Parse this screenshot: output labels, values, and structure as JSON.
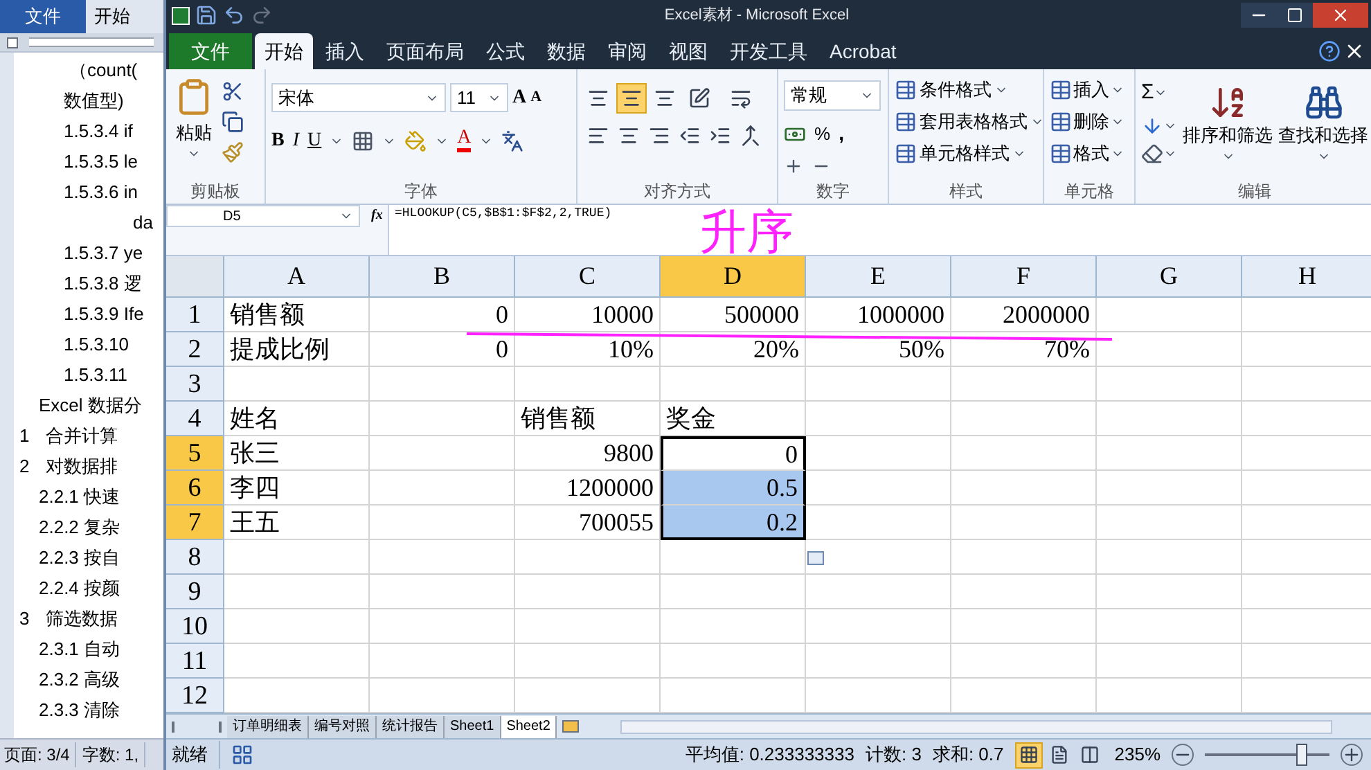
{
  "word": {
    "file_tab": "文件",
    "tabs": [
      "开始"
    ],
    "lines": [
      {
        "kind": "para",
        "text": "（count("
      },
      {
        "kind": "para2",
        "text": "数值型)"
      },
      {
        "kind": "sub",
        "text": "1.5.3.4 if"
      },
      {
        "kind": "sub",
        "text": "1.5.3.5 le"
      },
      {
        "kind": "sub",
        "text": "1.5.3.6 in"
      },
      {
        "kind": "cont",
        "text": "da"
      },
      {
        "kind": "sub",
        "text": "1.5.3.7 ye"
      },
      {
        "kind": "sub",
        "text": "1.5.3.8 逻"
      },
      {
        "kind": "sub",
        "text": "1.5.3.9 Ife"
      },
      {
        "kind": "sub",
        "text": "1.5.3.10"
      },
      {
        "kind": "sub",
        "text": "1.5.3.11"
      },
      {
        "kind": "chapter",
        "text": "Excel 数据分"
      },
      {
        "kind": "section",
        "number": "1",
        "text": "合并计算"
      },
      {
        "kind": "section",
        "number": "2",
        "text": "对数据排"
      },
      {
        "kind": "item",
        "text": "2.2.1 快速"
      },
      {
        "kind": "item",
        "text": "2.2.2 复杂"
      },
      {
        "kind": "item",
        "text": "2.2.3 按自"
      },
      {
        "kind": "item",
        "text": "2.2.4 按颜"
      },
      {
        "kind": "section",
        "number": "3",
        "text": "筛选数据"
      },
      {
        "kind": "item",
        "text": "2.3.1 自动"
      },
      {
        "kind": "item",
        "text": "2.3.2 高级"
      },
      {
        "kind": "item",
        "text": "2.3.3 清除"
      }
    ],
    "status": [
      "页面: 3/4",
      "字数: 1,"
    ]
  },
  "excel": {
    "title": "Excel素材 - Microsoft Excel",
    "file_tab": "文件",
    "tabs": [
      {
        "label": "开始",
        "selected": true
      },
      {
        "label": "插入",
        "selected": false
      },
      {
        "label": "页面布局",
        "selected": false
      },
      {
        "label": "公式",
        "selected": false
      },
      {
        "label": "数据",
        "selected": false
      },
      {
        "label": "审阅",
        "selected": false
      },
      {
        "label": "视图",
        "selected": false
      },
      {
        "label": "开发工具",
        "selected": false
      },
      {
        "label": "Acrobat",
        "selected": false
      }
    ],
    "ribbon": {
      "clipboard": {
        "paste": "粘贴",
        "label": "剪贴板"
      },
      "font": {
        "name": "宋体",
        "size": "11",
        "grow": "A",
        "shrink": "A",
        "bold": "B",
        "italic": "I",
        "underline": "U",
        "color_letter": "A",
        "label": "字体"
      },
      "alignment": {
        "label": "对齐方式",
        "vertical": [
          {
            "selected": false
          },
          {
            "selected": true
          },
          {
            "selected": false
          }
        ]
      },
      "number": {
        "format": "常规",
        "percent": "%",
        "comma": ",",
        "label": "数字"
      },
      "styles": {
        "items": [
          "条件格式",
          "套用表格格式",
          "单元格样式"
        ],
        "label": "样式"
      },
      "cells": {
        "items": [
          "插入",
          "删除",
          "格式"
        ],
        "label": "单元格"
      },
      "editing": {
        "sum": "Σ",
        "sort": "排序和筛选",
        "find": "查找和选择",
        "label": "编辑"
      }
    },
    "name_box": "D5",
    "function_label": "fx",
    "formula": "=HLOOKUP(C5,$B$1:$F$2,2,TRUE)",
    "annotation": "升序",
    "grid": {
      "columns": [
        {
          "label": "A",
          "selected": false
        },
        {
          "label": "B",
          "selected": false
        },
        {
          "label": "C",
          "selected": false
        },
        {
          "label": "D",
          "selected": true
        },
        {
          "label": "E",
          "selected": false
        },
        {
          "label": "F",
          "selected": false
        },
        {
          "label": "G",
          "selected": false
        },
        {
          "label": "H",
          "selected": false
        }
      ],
      "rows": [
        {
          "label": "1",
          "selected": false,
          "cells": [
            {
              "text": "销售额",
              "kind": "text"
            },
            {
              "text": "0",
              "kind": "number"
            },
            {
              "text": "10000",
              "kind": "number"
            },
            {
              "text": "500000",
              "kind": "number"
            },
            {
              "text": "1000000",
              "kind": "number"
            },
            {
              "text": "2000000",
              "kind": "number"
            },
            {},
            {}
          ]
        },
        {
          "label": "2",
          "selected": false,
          "cells": [
            {
              "text": "提成比例",
              "kind": "text"
            },
            {
              "text": "0",
              "kind": "number"
            },
            {
              "text": "10%",
              "kind": "number"
            },
            {
              "text": "20%",
              "kind": "number"
            },
            {
              "text": "50%",
              "kind": "number"
            },
            {
              "text": "70%",
              "kind": "number"
            },
            {},
            {}
          ]
        },
        {
          "label": "3",
          "selected": false,
          "cells": [
            {},
            {},
            {},
            {},
            {},
            {},
            {},
            {}
          ]
        },
        {
          "label": "4",
          "selected": false,
          "cells": [
            {
              "text": "姓名",
              "kind": "text"
            },
            {},
            {
              "text": "销售额",
              "kind": "text"
            },
            {
              "text": "奖金",
              "kind": "text"
            },
            {},
            {},
            {},
            {}
          ]
        },
        {
          "label": "5",
          "selected": true,
          "cells": [
            {
              "text": "张三",
              "kind": "text"
            },
            {},
            {
              "text": "9800",
              "kind": "number"
            },
            {
              "text": "0",
              "kind": "number",
              "selected": true,
              "active": true
            },
            {},
            {},
            {},
            {}
          ]
        },
        {
          "label": "6",
          "selected": true,
          "cells": [
            {
              "text": "李四",
              "kind": "text"
            },
            {},
            {
              "text": "1200000",
              "kind": "number"
            },
            {
              "text": "0.5",
              "kind": "number",
              "selected": true,
              "active": false
            },
            {},
            {},
            {},
            {}
          ]
        },
        {
          "label": "7",
          "selected": true,
          "cells": [
            {
              "text": "王五",
              "kind": "text"
            },
            {},
            {
              "text": "700055",
              "kind": "number"
            },
            {
              "text": "0.2",
              "kind": "number",
              "selected": true,
              "active": false
            },
            {},
            {},
            {},
            {}
          ]
        },
        {
          "label": "8",
          "selected": false,
          "cells": [
            {},
            {},
            {},
            {},
            {},
            {},
            {},
            {}
          ]
        },
        {
          "label": "9",
          "selected": false,
          "cells": [
            {},
            {},
            {},
            {},
            {},
            {},
            {},
            {}
          ]
        },
        {
          "label": "10",
          "selected": false,
          "cells": [
            {},
            {},
            {},
            {},
            {},
            {},
            {},
            {}
          ]
        },
        {
          "label": "11",
          "selected": false,
          "cells": [
            {},
            {},
            {},
            {},
            {},
            {},
            {},
            {}
          ]
        },
        {
          "label": "12",
          "selected": false,
          "cells": [
            {},
            {},
            {},
            {},
            {},
            {},
            {},
            {}
          ]
        }
      ]
    },
    "sheet_tabs": [
      {
        "label": "订单明细表",
        "selected": false
      },
      {
        "label": "编号对照",
        "selected": false
      },
      {
        "label": "统计报告",
        "selected": false
      },
      {
        "label": "Sheet1",
        "selected": false
      },
      {
        "label": "Sheet2",
        "selected": true
      }
    ],
    "status": {
      "ready": "就绪",
      "average": "平均值: 0.233333333",
      "count": "计数: 3",
      "sum": "求和: 0.7",
      "views": [
        {
          "kind": "normal",
          "selected": true
        },
        {
          "kind": "layout",
          "selected": false
        },
        {
          "kind": "break",
          "selected": false
        }
      ],
      "zoom": "235%",
      "zoom_slider": {
        "level": 0.78
      }
    }
  }
}
